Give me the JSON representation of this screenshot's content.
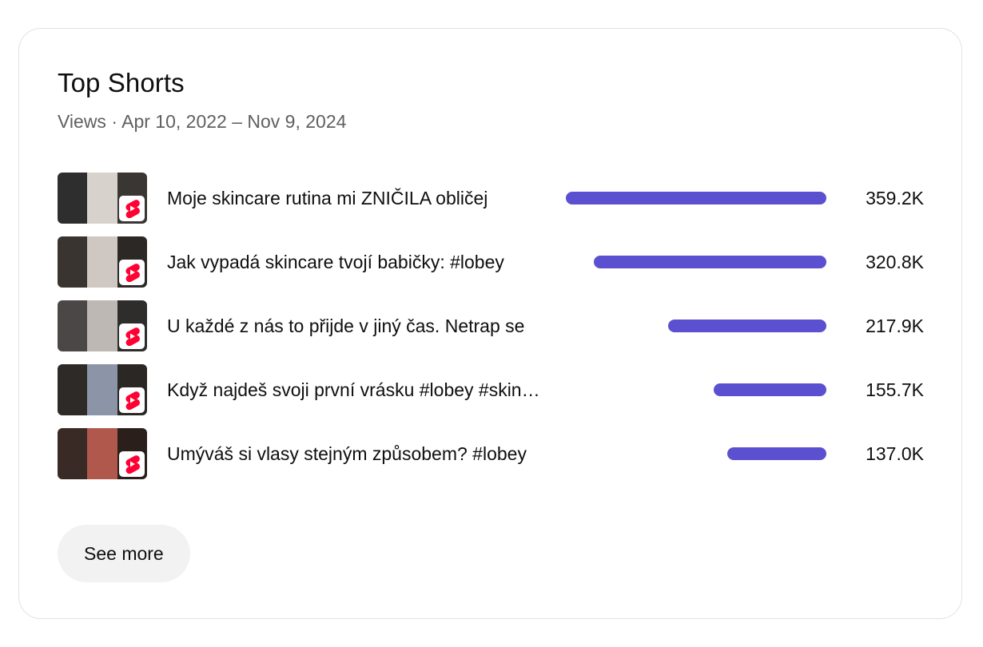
{
  "card": {
    "title": "Top Shorts",
    "subtitle": "Views · Apr 10, 2022 – Nov 9, 2024"
  },
  "colors": {
    "bar": "#5b50cf",
    "shorts_badge": "#ff0033"
  },
  "items": [
    {
      "title": "Moje skincare rutina mi ZNIČILA obličej",
      "views": "359.2K",
      "views_value": 359200,
      "thumb_colors": [
        "#2e2e2e",
        "#d8d2cc",
        "#3a3634"
      ],
      "badge_icon": "youtube-shorts-icon"
    },
    {
      "title": "Jak vypadá skincare tvojí babičky: #lobey",
      "views": "320.8K",
      "views_value": 320800,
      "thumb_colors": [
        "#3a3431",
        "#cfc7c1",
        "#2c2826"
      ],
      "badge_icon": "youtube-shorts-icon"
    },
    {
      "title": "U každé z nás to přijde v jiný čas. Netrap se",
      "views": "217.9K",
      "views_value": 217900,
      "thumb_colors": [
        "#4a4746",
        "#bdb8b4",
        "#2f2d2c"
      ],
      "badge_icon": "youtube-shorts-icon"
    },
    {
      "title": "Když najdeš svoji první vrásku #lobey #skincare",
      "views": "155.7K",
      "views_value": 155700,
      "thumb_colors": [
        "#2e2a28",
        "#8c94a8",
        "#2a2725"
      ],
      "badge_icon": "youtube-shorts-icon"
    },
    {
      "title": "Umýváš si vlasy stejným způsobem? #lobey",
      "views": "137.0K",
      "views_value": 137000,
      "thumb_colors": [
        "#3a2a26",
        "#b0584c",
        "#2b1f1c"
      ],
      "badge_icon": "youtube-shorts-icon"
    }
  ],
  "actions": {
    "see_more_label": "See more"
  }
}
